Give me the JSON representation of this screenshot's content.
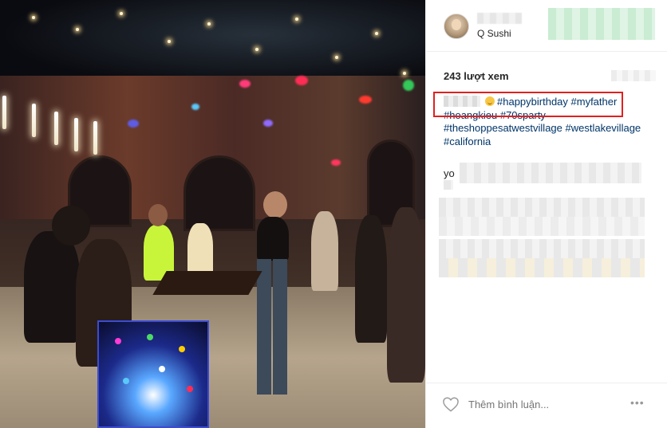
{
  "post": {
    "location": "Q Sushi",
    "views": "243 lượt xem",
    "caption_tags_line1": "#happybirthday #myfather",
    "caption_tags_line2": "#hoangkieu #70sparty",
    "caption_tags_line3": "#theshoppesatwestvillage #westlakevillage",
    "caption_tags_line4": "#california",
    "comment_prefix": "yo"
  },
  "actions": {
    "comment_placeholder": "Thêm bình luận...",
    "more_label": "•••"
  },
  "icons": {
    "like": "heart-icon",
    "more": "more-options-icon",
    "avatar": "avatar"
  },
  "colors": {
    "hashtag": "#003569",
    "highlight": "#e02020",
    "border": "#efefef"
  }
}
